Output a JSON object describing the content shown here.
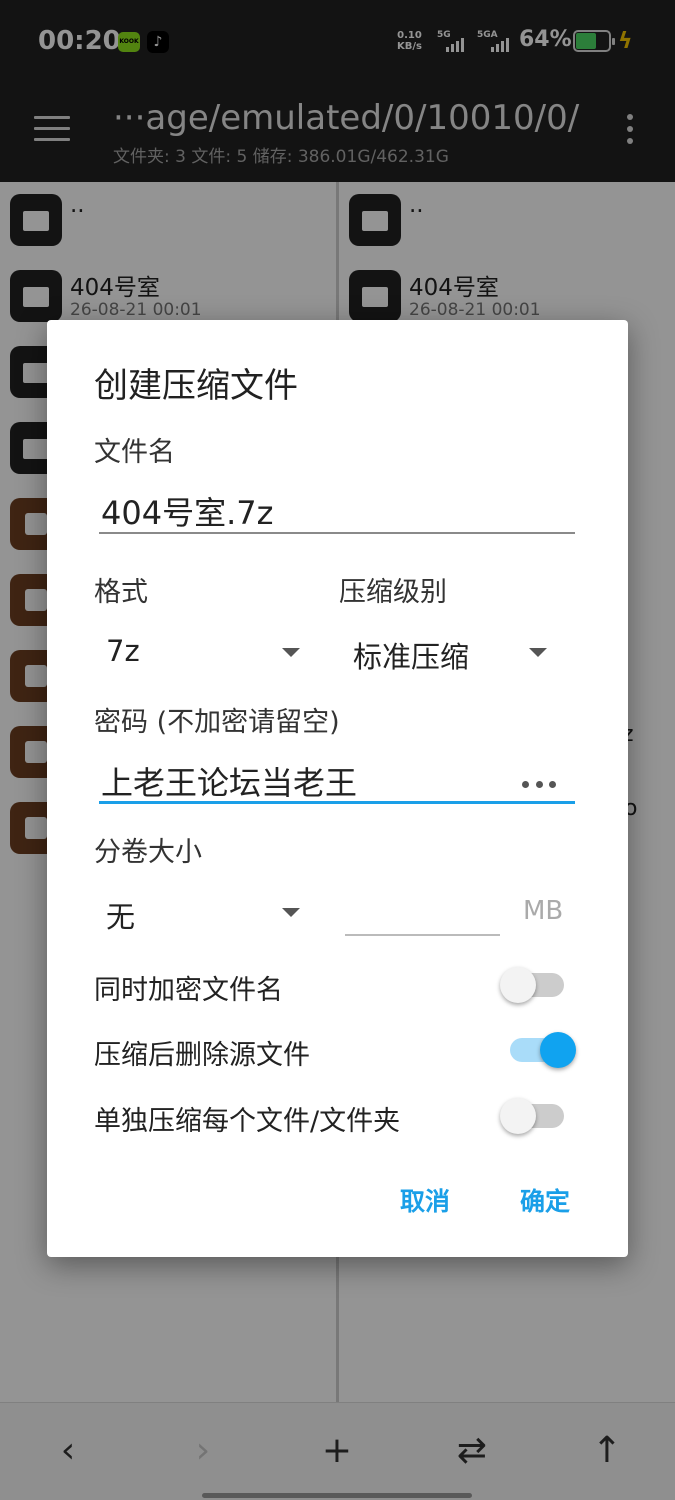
{
  "status_bar": {
    "time": "00:20",
    "app_a": "KOOK",
    "app_b": "♪",
    "net_speed_value": "0.10",
    "net_speed_unit": "KB/s",
    "sim1": "5G",
    "sim2": "5GA",
    "battery": "64%",
    "battery_level": 0.64
  },
  "app_bar": {
    "path": "···age/emulated/0/10010/0/",
    "summary": "文件夹: 3   文件: 5   储存: 386.01G/462.31G"
  },
  "left_pane": {
    "items": [
      {
        "name": "..",
        "date": "",
        "kind": "folder"
      },
      {
        "name": "404号室",
        "date": "26-08-21 00:01",
        "kind": "folder"
      }
    ]
  },
  "right_pane": {
    "items": [
      {
        "name": "..",
        "date": "",
        "kind": "folder"
      },
      {
        "name": "404号室",
        "date": "26-08-21 00:01",
        "kind": "folder"
      }
    ],
    "fragments": [
      "z",
      "o"
    ]
  },
  "dialog": {
    "title": "创建压缩文件",
    "filename_label": "文件名",
    "filename_value": "404号室.7z",
    "format_label": "格式",
    "format_value": "7z",
    "level_label": "压缩级别",
    "level_value": "标准压缩",
    "password_label": "密码 (不加密请留空)",
    "password_value": "上老王论坛当老王",
    "split_label": "分卷大小",
    "split_value": "无",
    "split_unit": "MB",
    "options": [
      {
        "label": "同时加密文件名",
        "on": false
      },
      {
        "label": "压缩后删除源文件",
        "on": true
      },
      {
        "label": "单独压缩每个文件/文件夹",
        "on": false
      }
    ],
    "cancel_label": "取消",
    "ok_label": "确定"
  },
  "toolbar": {
    "back": "‹",
    "forward": "›",
    "add": "+",
    "swap": "⇄",
    "up": "↑"
  },
  "colors": {
    "accent": "#1a9fe8",
    "appbar": "#212121",
    "archive_icon": "#6d3e22"
  }
}
